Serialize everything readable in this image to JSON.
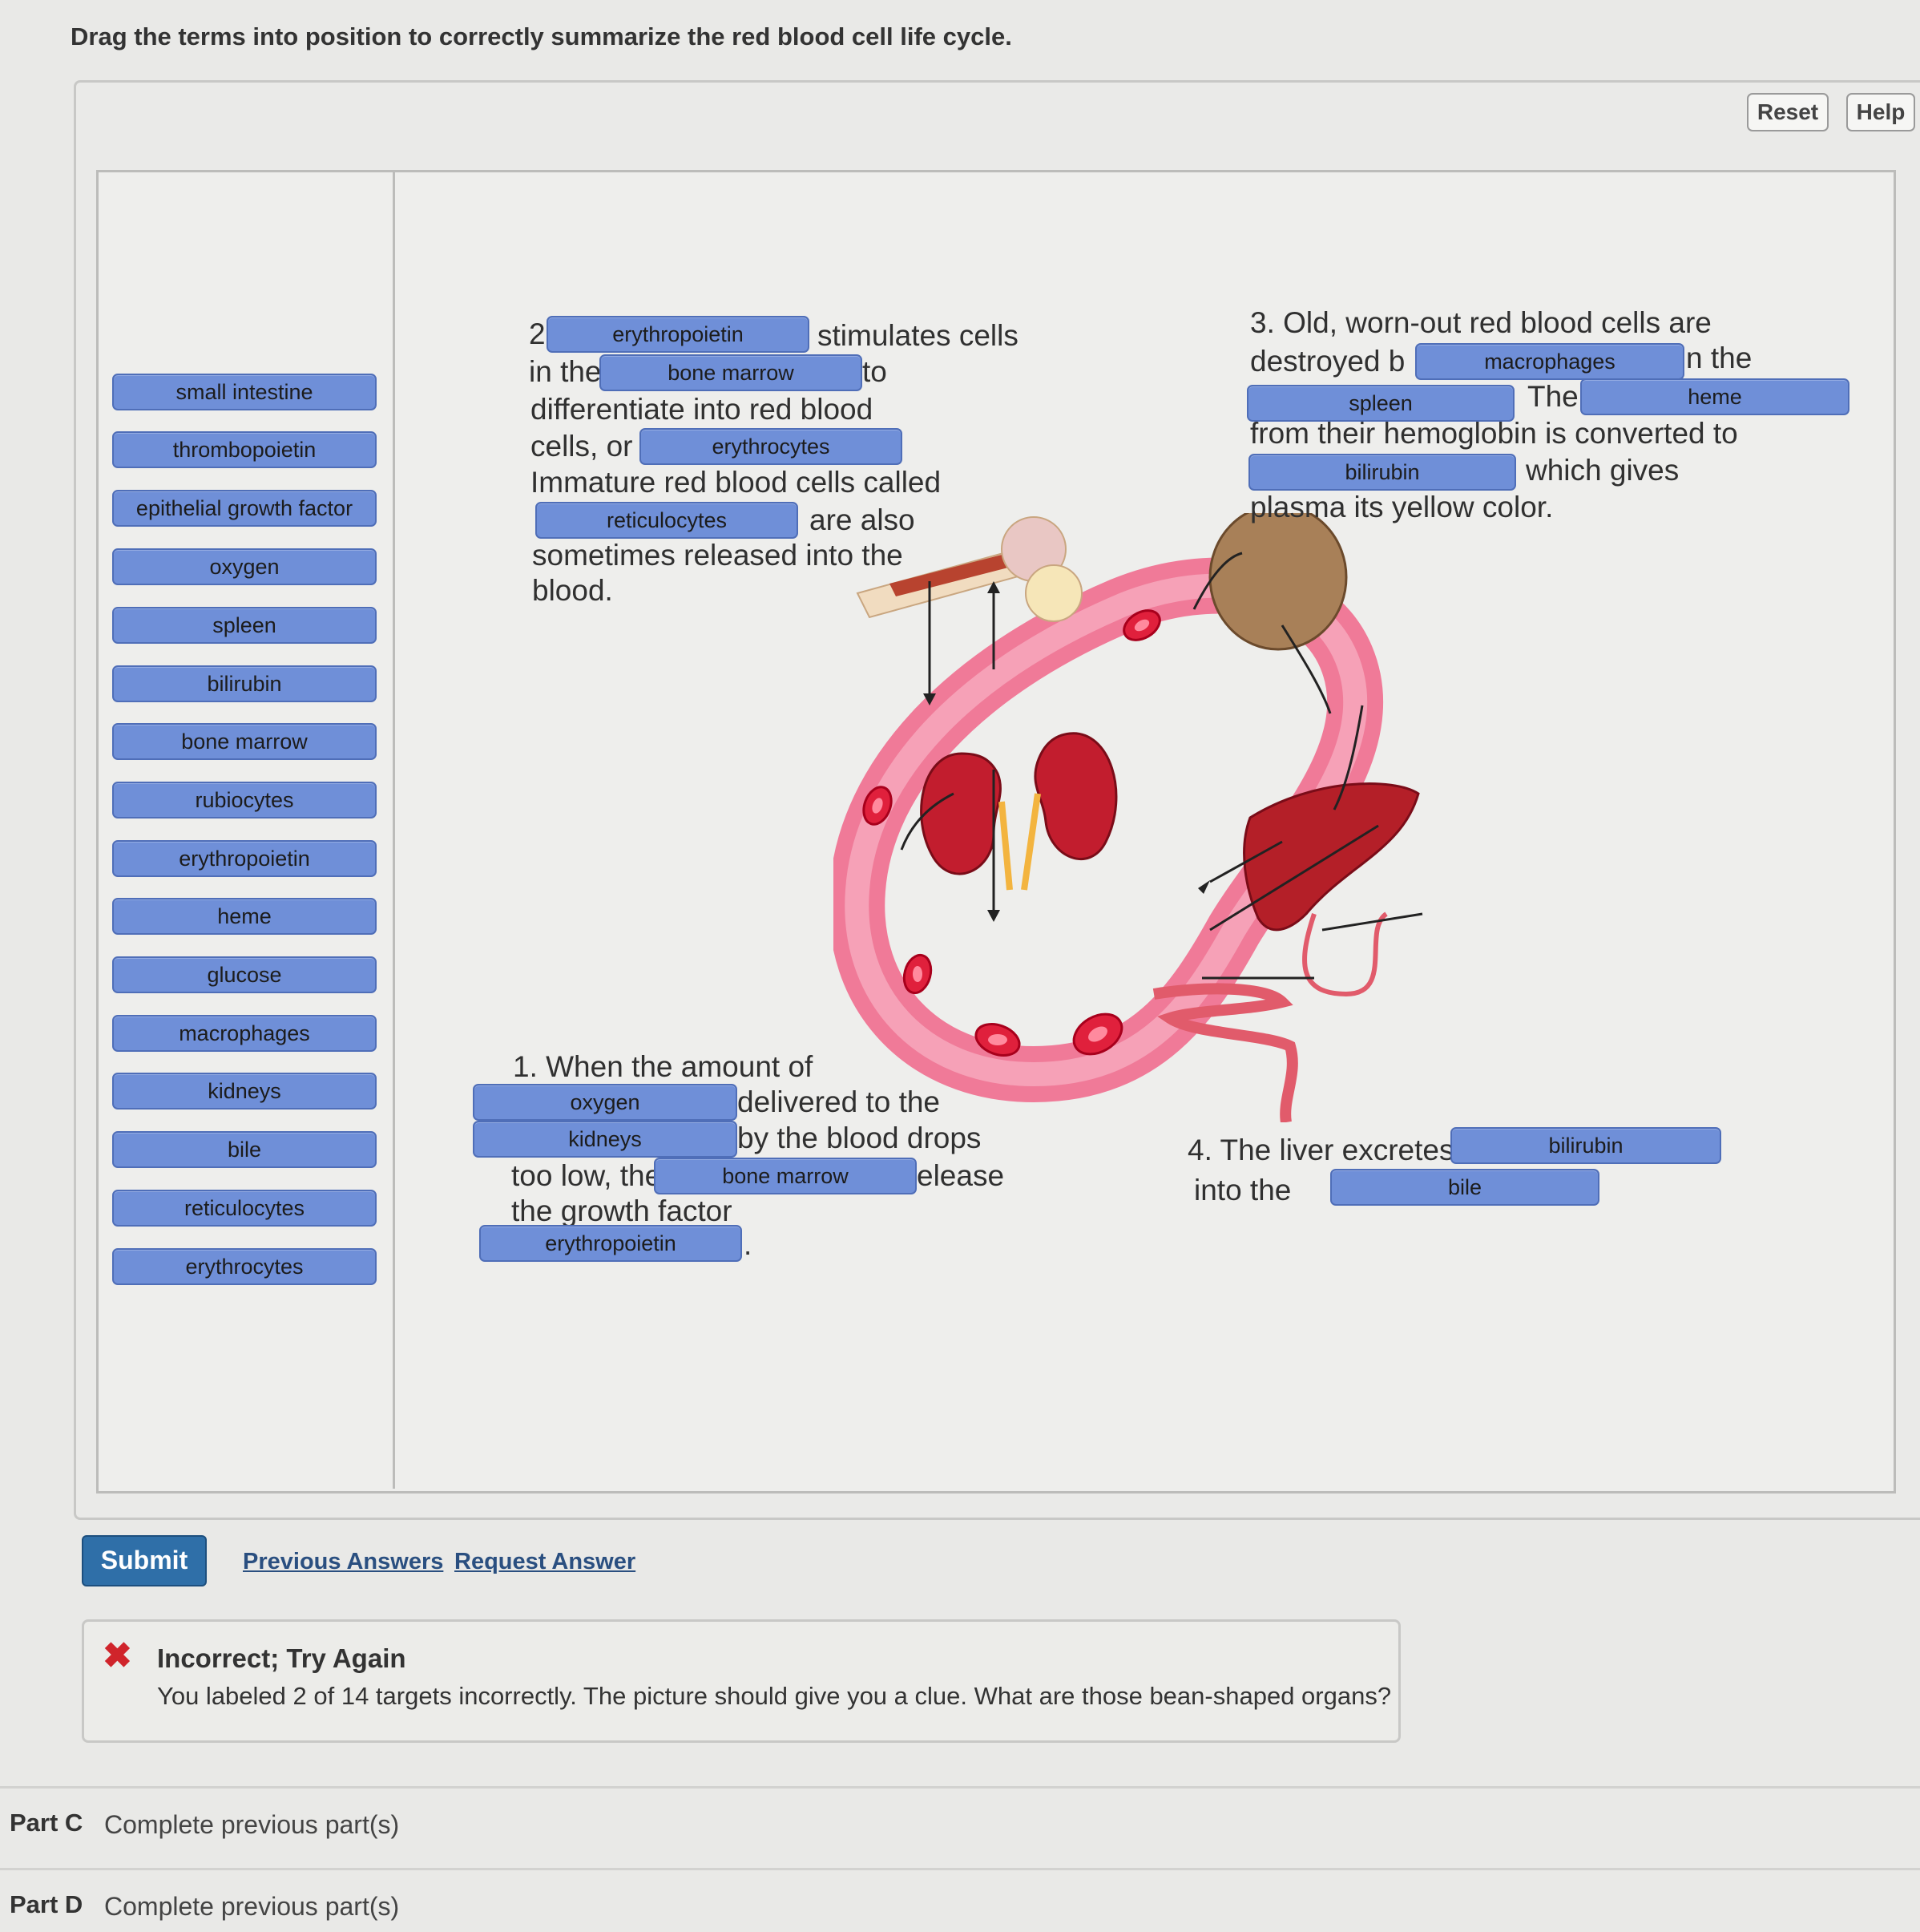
{
  "instruction": "Drag the terms into position to correctly summarize the red blood cell life cycle.",
  "toolbar": {
    "reset": "Reset",
    "help": "Help"
  },
  "term_bank": [
    "small intestine",
    "thrombopoietin",
    "epithelial growth factor",
    "oxygen",
    "spleen",
    "bilirubin",
    "bone marrow",
    "rubiocytes",
    "erythropoietin",
    "heme",
    "glucose",
    "macrophages",
    "kidneys",
    "bile",
    "reticulocytes",
    "erythrocytes"
  ],
  "step2": {
    "num": "2",
    "t1": "stimulates cells",
    "t2": "in the",
    "t3": "to",
    "t4": "differentiate into red blood",
    "t5": "cells, or",
    "t6": "Immature red blood cells called",
    "t7": "are also",
    "t8": "sometimes released into the",
    "t9": "blood.",
    "drop1": "erythropoietin",
    "drop2": "bone marrow",
    "drop3": "erythrocytes",
    "drop4": "reticulocytes"
  },
  "step3": {
    "t1": "3. Old, worn-out red blood cells are",
    "t2": "destroyed b",
    "t3": "n the",
    "t4": "The",
    "t5": "from their hemoglobin is converted to",
    "t6": "which gives",
    "t7": "plasma its yellow color.",
    "drop1": "macrophages",
    "drop2": "spleen",
    "drop3": "heme",
    "drop4": "bilirubin"
  },
  "step1": {
    "t1": "1. When the amount of",
    "t2": "delivered to the",
    "t3": "by the blood drops",
    "t4": "too low, the",
    "t5": "elease",
    "t6": "the growth factor",
    "t7": ".",
    "drop1": "oxygen",
    "drop2": "kidneys",
    "drop3": "bone marrow",
    "drop4": "erythropoietin"
  },
  "step4": {
    "t1": "4. The liver excretes",
    "t2": "into the",
    "drop1": "bilirubin",
    "drop2": "bile"
  },
  "actions": {
    "submit": "Submit",
    "previous_answers": "Previous Answers",
    "request_answer": "Request Answer"
  },
  "feedback": {
    "title": "Incorrect; Try Again",
    "message": "You labeled 2 of 14 targets incorrectly. The picture should give you a clue. What are those bean-shaped organs?"
  },
  "parts": [
    {
      "label": "Part C",
      "status": "Complete previous part(s)"
    },
    {
      "label": "Part D",
      "status": "Complete previous part(s)"
    }
  ],
  "colors": {
    "chip": "#6f8fd8",
    "submit": "#2f6fa8",
    "error": "#d0242b",
    "vessel": "#f07a98"
  }
}
